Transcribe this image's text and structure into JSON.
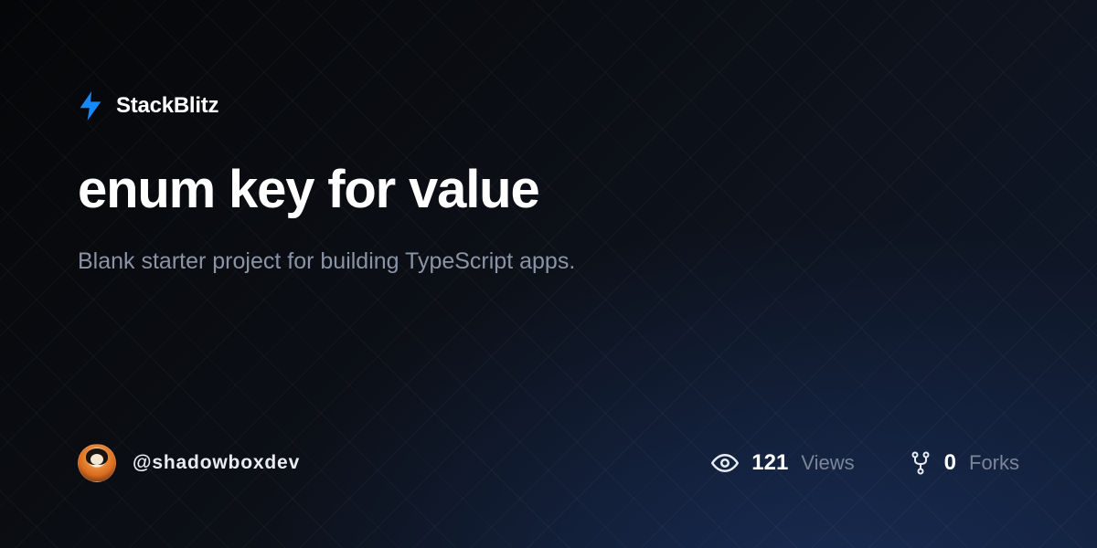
{
  "brand": {
    "name": "StackBlitz"
  },
  "project": {
    "title": "enum key for value",
    "description": "Blank starter project for building TypeScript apps."
  },
  "author": {
    "handle": "@shadowboxdev"
  },
  "stats": {
    "views": {
      "count": "121",
      "label": "Views"
    },
    "forks": {
      "count": "0",
      "label": "Forks"
    }
  },
  "colors": {
    "accent": "#1389fd"
  }
}
